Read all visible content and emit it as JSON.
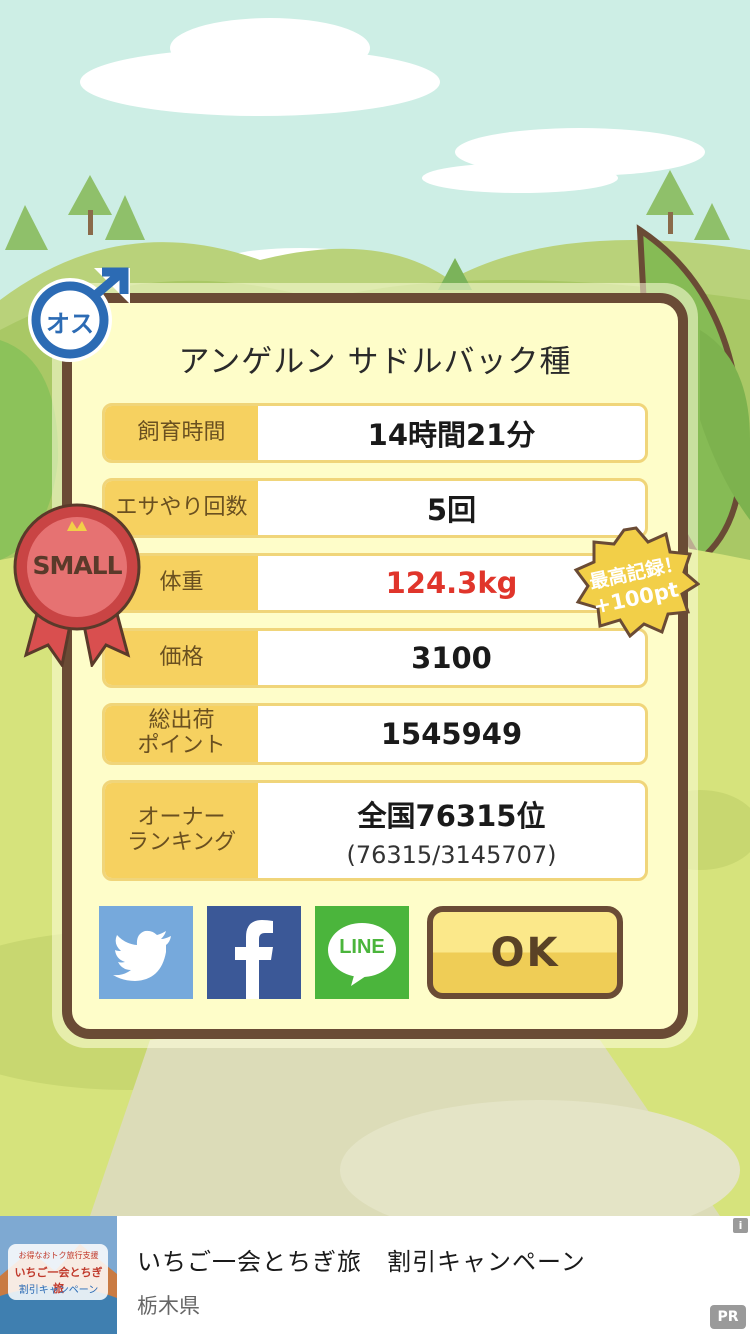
{
  "dialog": {
    "title": "アンゲルン サドルバック種",
    "rows": [
      {
        "label": "飼育時間",
        "value": "14時間21分"
      },
      {
        "label": "エサやり回数",
        "value": "5回"
      },
      {
        "label": "体重",
        "value": "124.3kg",
        "value_color": "#e0352b"
      },
      {
        "label": "価格",
        "value": "3100"
      },
      {
        "label": "総出荷\nポイント",
        "value": "1545949"
      },
      {
        "label": "オーナー\nランキング",
        "value": "全国76315位",
        "sub": "(76315/3145707)"
      }
    ],
    "ok_label": "OK"
  },
  "badges": {
    "gender": "オス",
    "size": "SMALL",
    "record_line1": "最高記録！",
    "record_line2": "+100pt"
  },
  "share": {
    "twitter_icon": "twitter-bird-icon",
    "facebook_icon": "facebook-f-icon",
    "line_label": "LINE"
  },
  "ad": {
    "title": "いちご一会とちぎ旅　割引キャンペーン",
    "subtitle": "栃木県",
    "info": "i",
    "pr": "PR",
    "thumb_line1": "お得なおトク旅行支援",
    "thumb_line2": "いちご一会とちぎ旅",
    "thumb_line3": "割引キャンペーン"
  },
  "colors": {
    "frame": "#6a4b35",
    "panel": "#fefdc9",
    "label_bg": "#f6d160",
    "twitter": "#76a9dc",
    "facebook": "#3b5897",
    "line": "#4bb53c",
    "record_red": "#e0352b"
  }
}
